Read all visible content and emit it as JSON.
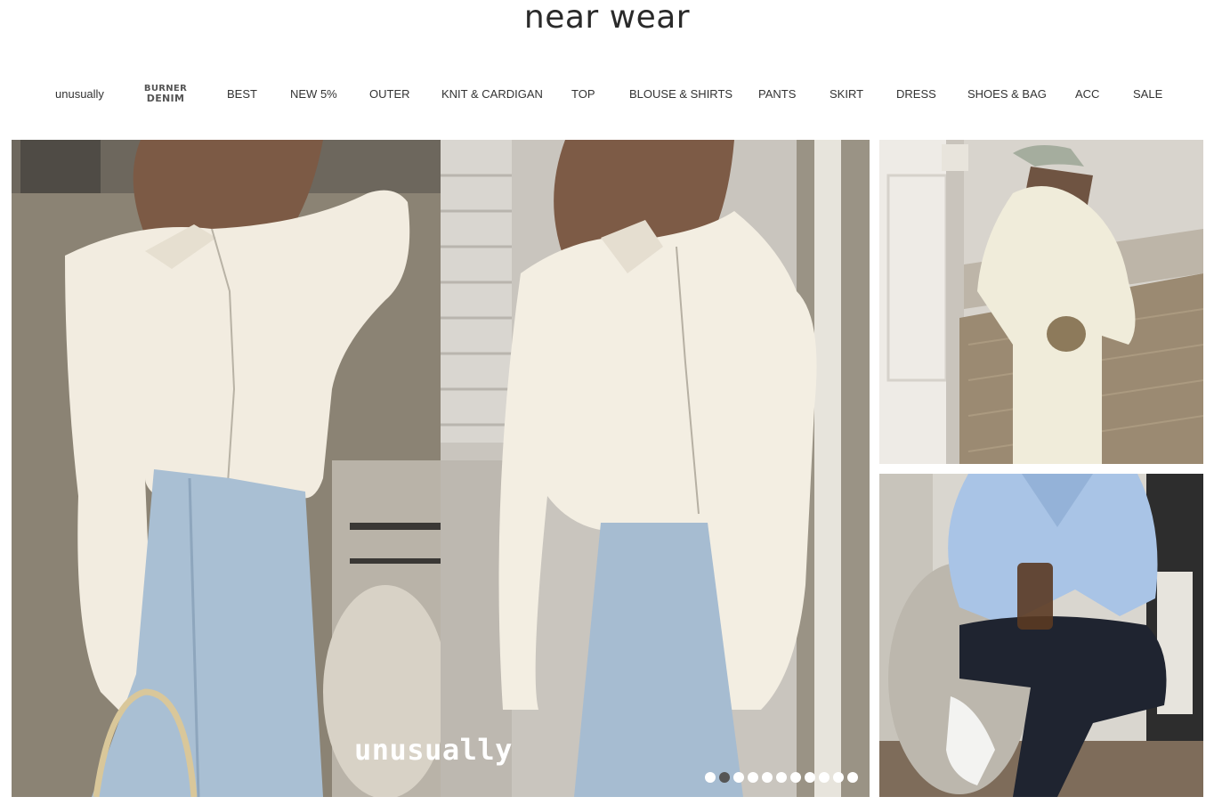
{
  "brand": {
    "logo_text": "near wear"
  },
  "nav": {
    "items": [
      {
        "label": "unusually"
      },
      {
        "label_line1": "BURNER",
        "label_line2": "DENIM"
      },
      {
        "label": "BEST"
      },
      {
        "label": "NEW 5%"
      },
      {
        "label": "OUTER"
      },
      {
        "label": "KNIT & CARDIGAN"
      },
      {
        "label": "TOP"
      },
      {
        "label": "BLOUSE & SHIRTS"
      },
      {
        "label": "PANTS"
      },
      {
        "label": "SKIRT"
      },
      {
        "label": "DRESS"
      },
      {
        "label": "SHOES & BAG"
      },
      {
        "label": "ACC"
      },
      {
        "label": "SALE"
      }
    ]
  },
  "hero": {
    "caption": "unusually",
    "slide_count": 11,
    "active_slide": 2
  },
  "colors": {
    "text": "#333333",
    "dot_active": "#555555",
    "dot_inactive": "#ffffff"
  }
}
